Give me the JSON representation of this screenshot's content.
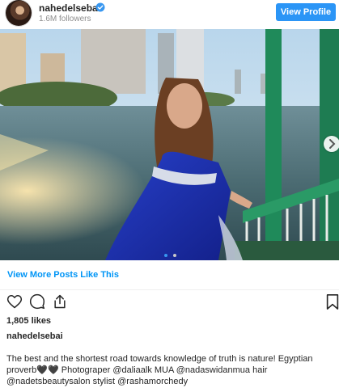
{
  "header": {
    "username": "nahedelsebai",
    "followers": "1.6M followers",
    "view_profile_label": "View Profile"
  },
  "post": {
    "carousel_dots": 2,
    "active_dot": 0,
    "view_more_label": "View More Posts Like This",
    "likes": "1,805 likes",
    "owner": "nahedelsebai",
    "caption_line1": "The best and the shortest road towards knowledge of truth is nature! Egyptian",
    "caption_line2": "proverb🖤🖤 Photograper @daliaalk MUA @nadaswidanmua hair",
    "caption_line3": "@nadetsbeautysalon stylist @rashamorchedy"
  },
  "icons": [
    "verified-badge-icon",
    "heart-icon",
    "comment-icon",
    "share-icon",
    "bookmark-icon",
    "chevron-right-icon"
  ],
  "colors": {
    "accent": "#2b95f6",
    "link": "#0095f6",
    "muted": "#8e8e8e",
    "text": "#262626"
  }
}
